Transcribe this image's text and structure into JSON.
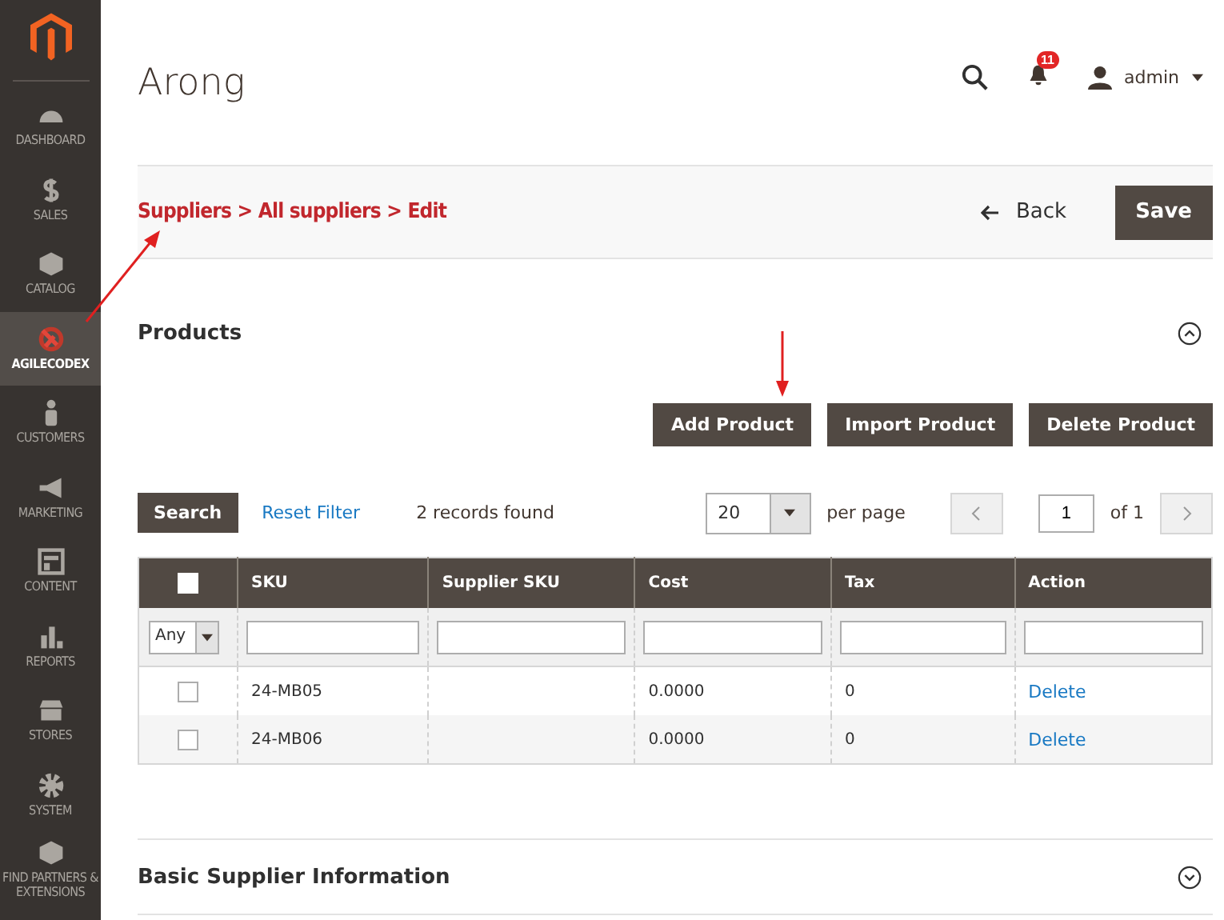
{
  "sidebar": {
    "items": [
      {
        "label": "DASHBOARD",
        "selected": false
      },
      {
        "label": "SALES",
        "selected": false
      },
      {
        "label": "CATALOG",
        "selected": false
      },
      {
        "label": "AGILECODEX",
        "selected": true
      },
      {
        "label": "CUSTOMERS",
        "selected": false
      },
      {
        "label": "MARKETING",
        "selected": false
      },
      {
        "label": "CONTENT",
        "selected": false
      },
      {
        "label": "REPORTS",
        "selected": false
      },
      {
        "label": "STORES",
        "selected": false
      },
      {
        "label": "SYSTEM",
        "selected": false
      },
      {
        "label": "FIND PARTNERS & EXTENSIONS",
        "selected": false
      }
    ]
  },
  "header": {
    "title": "Arong",
    "notification_count": "11",
    "user": "admin"
  },
  "breadcrumb": "Suppliers > All suppliers > Edit",
  "actions": {
    "back": "Back",
    "save": "Save"
  },
  "products": {
    "title": "Products",
    "expanded": true,
    "buttons": [
      "Add Product",
      "Import Product",
      "Delete Product"
    ],
    "search": "Search",
    "reset": "Reset Filter",
    "records": "2 records found",
    "per_page_value": "20",
    "per_page_label": "per page",
    "page": "1",
    "of_pages": "of 1",
    "table": {
      "select_all_checked": false,
      "columns": [
        "SKU",
        "Supplier SKU",
        "Cost",
        "Tax",
        "Action"
      ],
      "any_filter": "Any",
      "rows": [
        {
          "checked": false,
          "cells": [
            "24-MB05",
            "",
            "0.0000",
            "0"
          ],
          "action": "Delete"
        },
        {
          "checked": false,
          "cells": [
            "24-MB06",
            "",
            "0.0000",
            "0"
          ],
          "action": "Delete"
        }
      ]
    }
  },
  "basic_info": {
    "title": "Basic Supplier Information",
    "expanded": false
  }
}
